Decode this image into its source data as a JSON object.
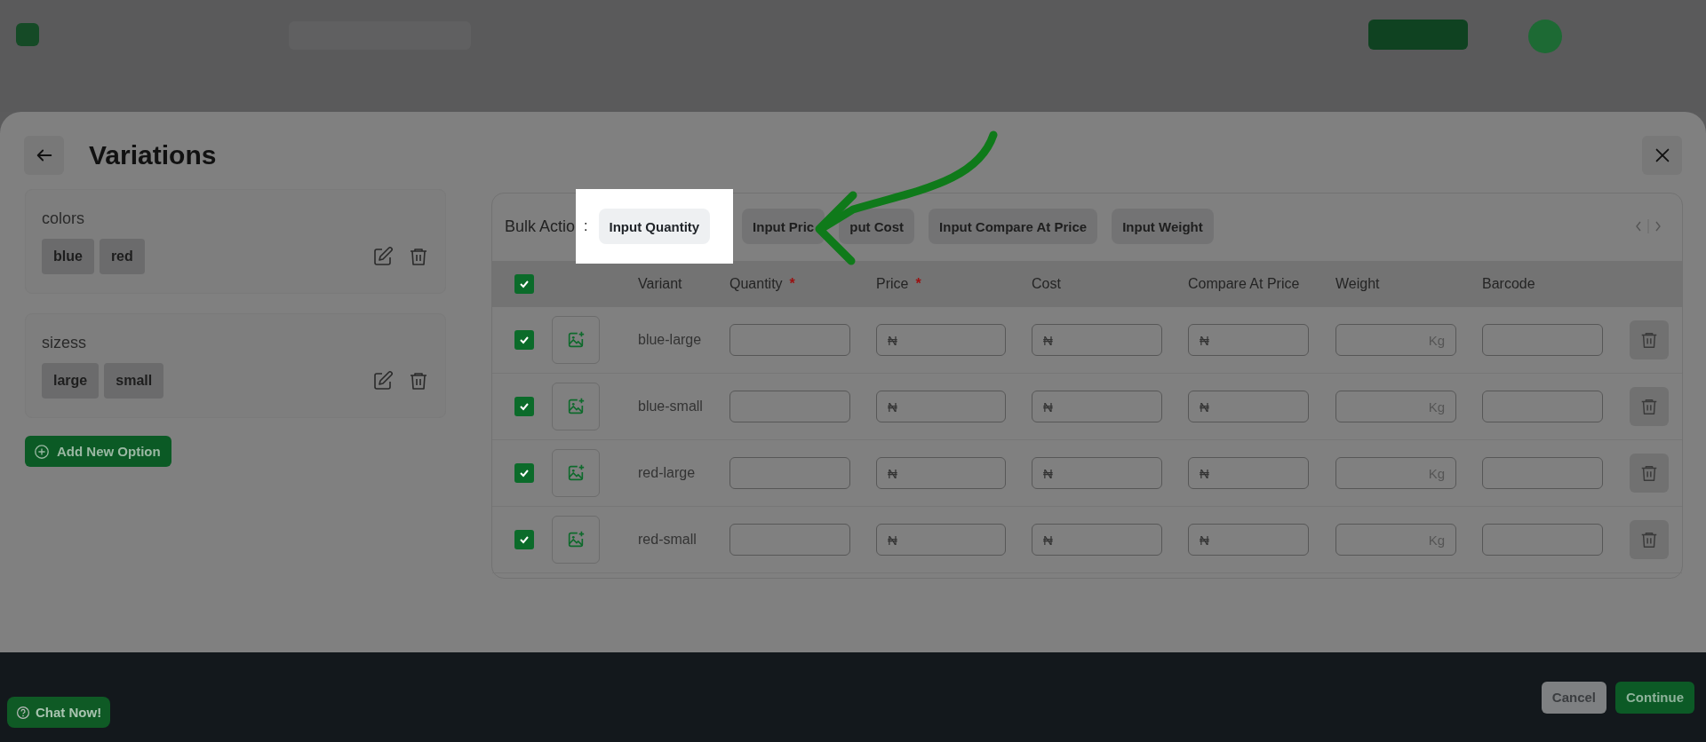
{
  "page": {
    "title": "Variations"
  },
  "options": [
    {
      "name": "colors",
      "values": [
        "blue",
        "red"
      ]
    },
    {
      "name": "sizess",
      "values": [
        "large",
        "small"
      ]
    }
  ],
  "add_option_button": "Add New Option",
  "bulk_action": {
    "label": "Bulk Actio",
    "separator": ":",
    "actions": [
      {
        "label": "Input Quantity",
        "highlighted": true
      },
      {
        "label": "Input Pric",
        "highlighted": false
      },
      {
        "label": "put Cost",
        "highlighted": false
      },
      {
        "label": "Input Compare At Price",
        "highlighted": false
      },
      {
        "label": "Input Weight",
        "highlighted": false
      }
    ]
  },
  "table": {
    "all_checked": true,
    "required_mark": "*",
    "columns": [
      {
        "label": "Variant",
        "required": false
      },
      {
        "label": "Quantity",
        "required": true
      },
      {
        "label": "Price",
        "required": true
      },
      {
        "label": "Cost",
        "required": false
      },
      {
        "label": "Compare At Price",
        "required": false
      },
      {
        "label": "Weight",
        "required": false
      },
      {
        "label": "Barcode",
        "required": false
      }
    ],
    "rows": [
      {
        "checked": true,
        "variant": "blue-large",
        "fields": [
          {
            "kind": "plain"
          },
          {
            "kind": "currency",
            "prefix": "₦"
          },
          {
            "kind": "currency",
            "prefix": "₦"
          },
          {
            "kind": "currency",
            "prefix": "₦"
          },
          {
            "kind": "unit",
            "suffix": "Kg"
          },
          {
            "kind": "plain"
          }
        ]
      },
      {
        "checked": true,
        "variant": "blue-small",
        "fields": [
          {
            "kind": "plain"
          },
          {
            "kind": "currency",
            "prefix": "₦"
          },
          {
            "kind": "currency",
            "prefix": "₦"
          },
          {
            "kind": "currency",
            "prefix": "₦"
          },
          {
            "kind": "unit",
            "suffix": "Kg"
          },
          {
            "kind": "plain"
          }
        ]
      },
      {
        "checked": true,
        "variant": "red-large",
        "fields": [
          {
            "kind": "plain"
          },
          {
            "kind": "currency",
            "prefix": "₦"
          },
          {
            "kind": "currency",
            "prefix": "₦"
          },
          {
            "kind": "currency",
            "prefix": "₦"
          },
          {
            "kind": "unit",
            "suffix": "Kg"
          },
          {
            "kind": "plain"
          }
        ]
      },
      {
        "checked": true,
        "variant": "red-small",
        "fields": [
          {
            "kind": "plain"
          },
          {
            "kind": "currency",
            "prefix": "₦"
          },
          {
            "kind": "currency",
            "prefix": "₦"
          },
          {
            "kind": "currency",
            "prefix": "₦"
          },
          {
            "kind": "unit",
            "suffix": "Kg"
          },
          {
            "kind": "plain"
          }
        ]
      }
    ]
  },
  "footer": {
    "buttons": [
      {
        "label": "Cancel",
        "kind": "secondary"
      },
      {
        "label": "Continue",
        "kind": "primary"
      }
    ]
  },
  "chat_button": "Chat Now!"
}
